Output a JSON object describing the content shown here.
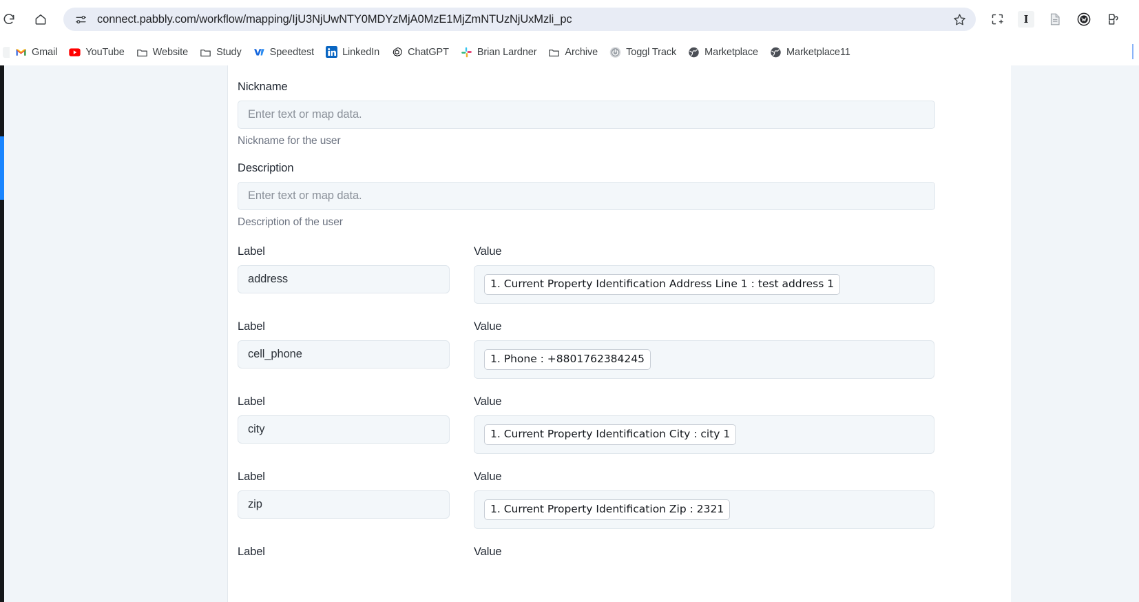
{
  "browser": {
    "url": "connect.pabbly.com/workflow/mapping/IjU3NjUwNTY0MDYzMjA0MzE1MjZmNTUzNjUxMzli_pc",
    "reload_icon": "reload-icon",
    "home_icon": "home-icon",
    "site_controls_icon": "site-settings-sliders-icon",
    "star_icon": "bookmark-star-icon",
    "extension_icons": [
      {
        "name": "screenshot-capture-icon",
        "label": ""
      },
      {
        "name": "text-tool-i-icon",
        "label": "I"
      },
      {
        "name": "document-reader-icon",
        "label": ""
      },
      {
        "name": "wallet-extension-icon",
        "label": ""
      },
      {
        "name": "extensions-puzzle-icon",
        "label": ""
      }
    ],
    "bookmarks": [
      {
        "label": "Gmail",
        "icon": "gmail-icon"
      },
      {
        "label": "YouTube",
        "icon": "youtube-icon"
      },
      {
        "label": "Website",
        "icon": "folder-icon"
      },
      {
        "label": "Study",
        "icon": "folder-icon"
      },
      {
        "label": "Speedtest",
        "icon": "speedtest-icon"
      },
      {
        "label": "LinkedIn",
        "icon": "linkedin-icon"
      },
      {
        "label": "ChatGPT",
        "icon": "chatgpt-icon"
      },
      {
        "label": "Brian Lardner",
        "icon": "slack-icon"
      },
      {
        "label": "Archive",
        "icon": "folder-icon"
      },
      {
        "label": "Toggl Track",
        "icon": "toggl-icon"
      },
      {
        "label": "Marketplace",
        "icon": "globe-icon"
      },
      {
        "label": "Marketplace11",
        "icon": "globe-icon"
      }
    ]
  },
  "colors": {
    "accent_blue": "#1a85ff",
    "omnibox_bg": "#e8ecf5",
    "input_bg": "#f3f7fa",
    "input_border": "#dfe6ec",
    "panel_bg": "#ffffff",
    "page_bg": "#f1f5f9",
    "rail_dark": "#15171a"
  },
  "form": {
    "fields": [
      {
        "label": "Nickname",
        "placeholder": "Enter text or map data.",
        "value": "",
        "help": "Nickname for the user"
      },
      {
        "label": "Description",
        "placeholder": "Enter text or map data.",
        "value": "",
        "help": "Description of the user"
      }
    ],
    "pair_headers": {
      "label": "Label",
      "value": "Value"
    },
    "pairs": [
      {
        "label_header": "Label",
        "value_header": "Value",
        "label_value": "address",
        "token": "1. Current Property Identification Address Line 1 : test address 1"
      },
      {
        "label_header": "Label",
        "value_header": "Value",
        "label_value": "cell_phone",
        "token": "1. Phone : +8801762384245"
      },
      {
        "label_header": "Label",
        "value_header": "Value",
        "label_value": "city",
        "token": "1. Current Property Identification City : city 1"
      },
      {
        "label_header": "Label",
        "value_header": "Value",
        "label_value": "zip",
        "token": "1. Current Property Identification Zip : 2321"
      }
    ],
    "next_pair_partial": {
      "label_header": "Label",
      "value_header": "Value"
    }
  }
}
